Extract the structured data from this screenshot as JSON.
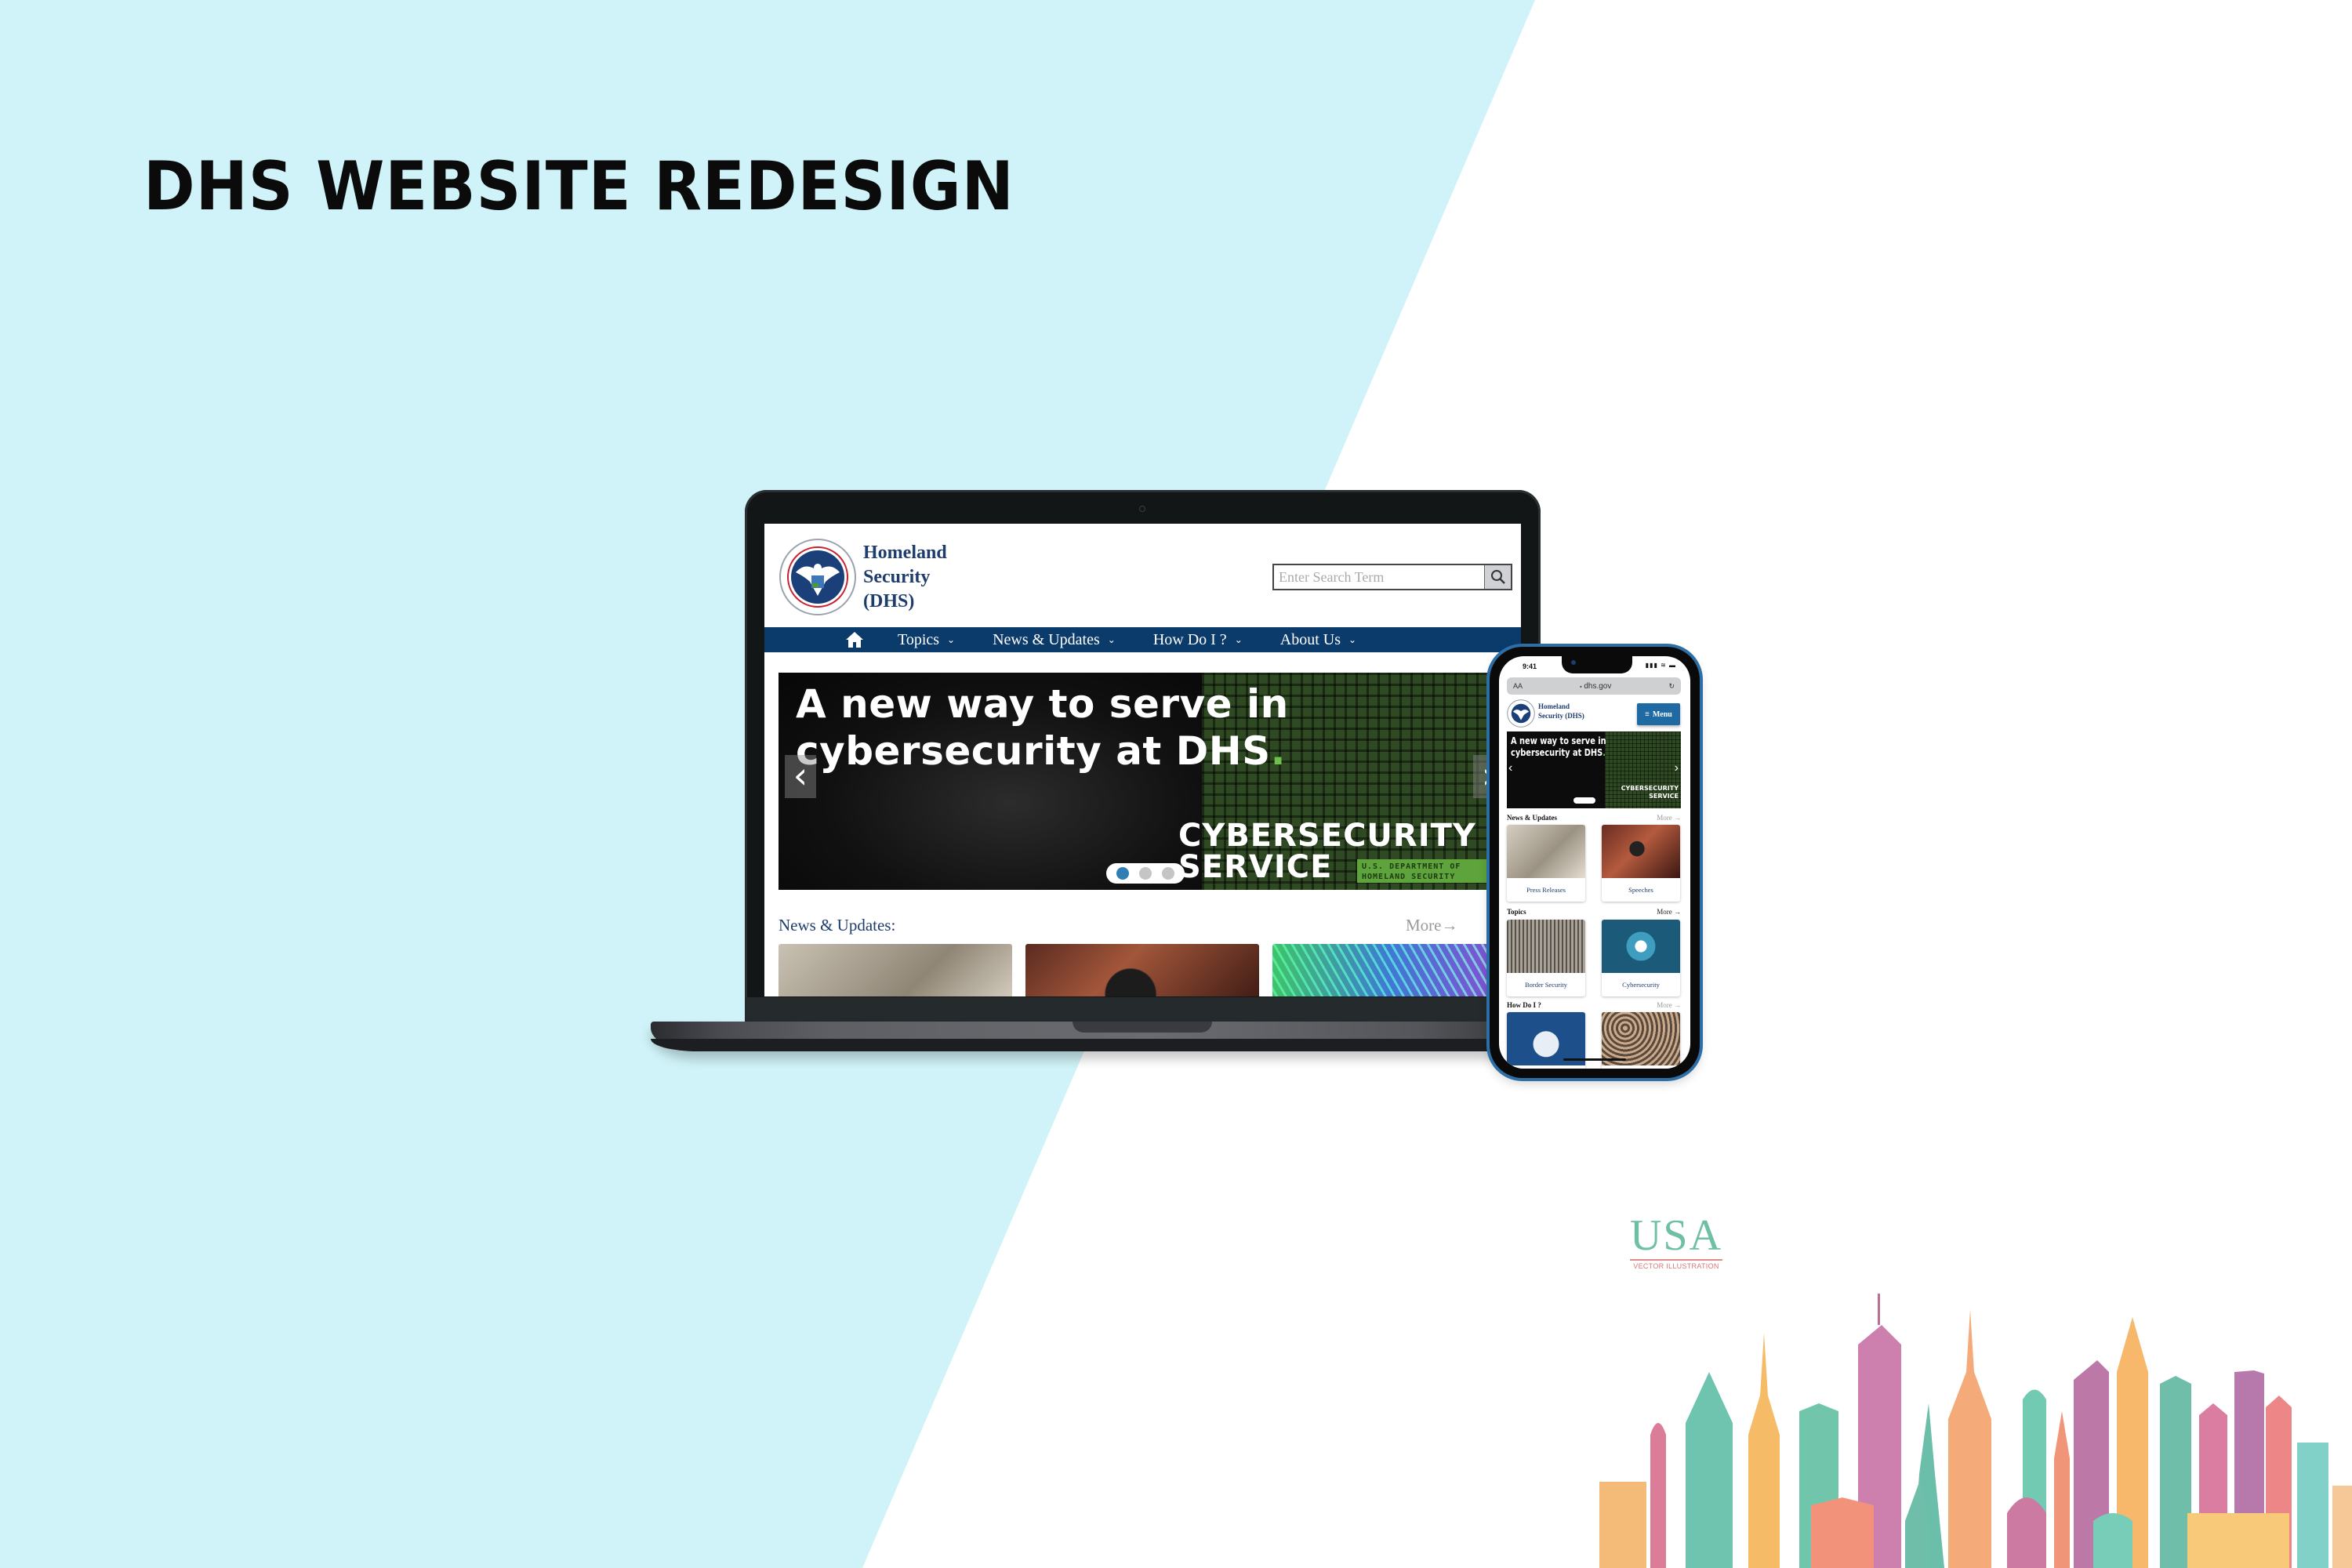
{
  "page": {
    "title": "DHS WEBSITE REDESIGN",
    "colors": {
      "background_left": "#cff3f8",
      "background_right": "#ffffff",
      "dhs_navy": "#0b3b6b",
      "dhs_text_blue": "#1f3d6c",
      "accent_green": "#5ea33b",
      "menu_blue": "#1f6aa3"
    }
  },
  "laptop": {
    "site": {
      "brand_lines": [
        "Homeland",
        "Security",
        "(DHS)"
      ],
      "logo_icon": "dhs-seal-icon",
      "search": {
        "placeholder": "Enter Search Term",
        "value": "",
        "button_icon": "search-icon"
      },
      "nav": {
        "home_icon": "home-icon",
        "items": [
          {
            "label": "Topics",
            "icon": "chevron-down-icon"
          },
          {
            "label": "News & Updates",
            "icon": "chevron-down-icon"
          },
          {
            "label": "How Do I ?",
            "icon": "chevron-down-icon"
          },
          {
            "label": "About Us",
            "icon": "chevron-down-icon"
          }
        ]
      },
      "hero": {
        "headline_line1": "A new way to serve in",
        "headline_line2": "cybersecurity at DHS",
        "headline_dot": ".",
        "badge_line1": "CYBERSECURITY",
        "badge_line2": "SERVICE",
        "tag_line1": "U.S. DEPARTMENT OF",
        "tag_line2": "HOMELAND SECURITY",
        "prev_icon": "chevron-left-icon",
        "next_icon": "chevron-right-icon",
        "prev_glyph": "‹",
        "next_glyph": "›",
        "slide_count": 3,
        "active_slide": 1
      },
      "news": {
        "heading": "News & Updates:",
        "more": "More→"
      }
    }
  },
  "phone": {
    "status": {
      "time": "9:41",
      "signal": "▮▮▮ ≋ ▬"
    },
    "browser": {
      "text_size": "AA",
      "lock_icon": "lock-icon",
      "url": "dhs.gov",
      "reload_icon": "reload-icon",
      "lock_glyph": "🔒",
      "reload_glyph": "↻"
    },
    "site": {
      "brand_line1": "Homeland",
      "brand_line2": "Security (DHS)",
      "menu_label": "Menu",
      "menu_glyph": "≡",
      "hero": {
        "headline_line1": "A new way to serve in",
        "headline_line2": "cybersecurity at DHS",
        "headline_dot": ".",
        "badge_line1": "CYBERSECURITY",
        "badge_line2": "SERVICE"
      },
      "sections": [
        {
          "heading": "News & Updates",
          "more": "More →",
          "cards": [
            {
              "label": "Press Releases"
            },
            {
              "label": "Speeches"
            }
          ]
        },
        {
          "heading": "Topics",
          "more": "More →",
          "cards": [
            {
              "label": "Border Security"
            },
            {
              "label": "Cybersecurity"
            }
          ]
        },
        {
          "heading": "How Do I ?",
          "more": "More →",
          "cards": [
            {
              "label": ""
            },
            {
              "label": ""
            }
          ]
        }
      ]
    }
  },
  "decor": {
    "usa_logo": {
      "title": "USA",
      "subtitle": "VECTOR ILLUSTRATION"
    },
    "skyline": "usa-city-skyline-illustration"
  }
}
